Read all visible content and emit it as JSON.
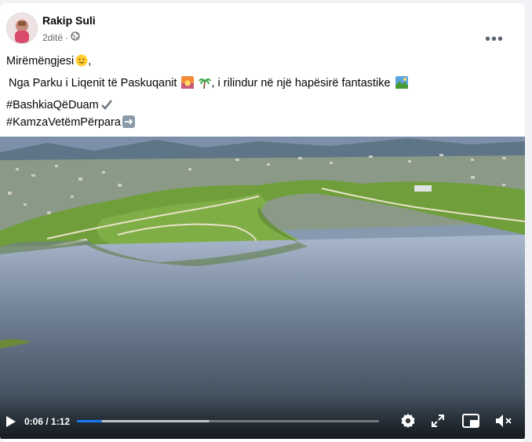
{
  "post": {
    "author": "Rakip Suli",
    "time": "2ditë",
    "separator": "·",
    "privacy_icon": "globe-icon",
    "more_icon": "more-dots-icon",
    "more_label": "•••"
  },
  "text": {
    "line1": "Mirëmëngjesi",
    "line1_suffix": ",",
    "line2_a": "Nga Parku i Liqenit të Paskuqanit",
    "line2_b": ", i rilindur në një hapësirë fantastike",
    "hashtag1": "#BashkiaQëDuam",
    "hashtag2": "#KamzaVetëmPërpara"
  },
  "video": {
    "time_label": "0:06 / 1:12",
    "progress": 0.083,
    "buffered": 0.44,
    "icons": [
      "play-icon",
      "settings-icon",
      "fullscreen-icon",
      "miniplayer-icon",
      "mute-icon"
    ]
  },
  "colors": {
    "accent": "#1877f2",
    "lake": "#3d4e5e",
    "grass": "#6f9e3a"
  }
}
